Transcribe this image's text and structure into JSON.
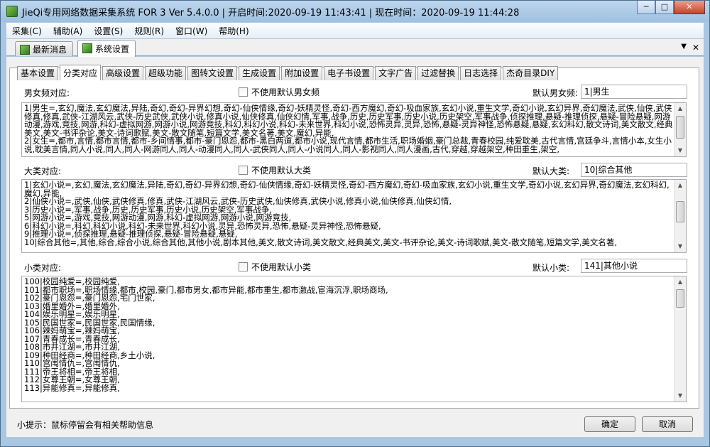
{
  "window": {
    "title": "JieQi专用网络数据采集系统 FOR 3 Ver 5.4.0.0 | 开启时间:2020-09-19 11:43:41 | 现在时间：2020-09-19 11:44:28",
    "minimize": "─",
    "maximize": "□",
    "close": "✕"
  },
  "menu": [
    "采集(C)",
    "辅助(A)",
    "设置(S)",
    "规则(R)",
    "窗口(W)",
    "帮助(H)"
  ],
  "mdi_tabs": [
    "最新消息",
    "系统设置"
  ],
  "mdi_controls": {
    "dropdown": "▼",
    "close": "✕"
  },
  "settings_tabs": [
    "基本设置",
    "分类对应",
    "高级设置",
    "超级功能",
    "图转文设置",
    "生成设置",
    "附加设置",
    "电子书设置",
    "文字广告",
    "过滤替换",
    "日志选择",
    "杰奇目录DIY"
  ],
  "gender": {
    "label": "男女频对应:",
    "checkbox": "不使用默认男女频",
    "default_label": "默认男女频:",
    "default_value": "1|男生",
    "lines": [
      "1|男生=,玄幻,魔法,玄幻魔法,异陆,奇幻,奇幻-异界幻想,奇幻-仙侠情缘,奇幻-妖精灵怪,奇幻-西方魔幻,奇幻-吸血家族,玄幻小说,重生文学,奇幻小说,玄幻异界,奇幻魔法,武侠,仙侠,武侠修真,修真,武侠-江湖风云,武侠-历史武侠,武侠小说,修真小说,仙侠修真,仙侠幻情,军事,战争,历史,历史军事,历史小说,历史架空,军事战争,侦探推理,悬疑-推理侦探,悬疑-冒险悬疑,网游动漫,游戏,竞技,网游,科幻-虚拟网游,网游小说,网游竞技,科幻,科幻小说,科幻-未来世界,科幻小说,恐怖灵异,灵异,恐怖,悬疑-灵异神怪,恐怖悬疑,悬疑,玄幻科幻,散文诗词,美文散文,经典美文,美文-书评杂论,美文-诗词歌赋,美文-散文随笔,短篇文学,美文名著,美文,魔幻,异能,",
      "2|女生=,都市,言情,都市言情,都市-乡间情事,都市-豪门恩怨,都市-黑白两道,都市小说,现代言情,都市生活,职场婚姻,豪门总裁,青春校园,纯爱耽美,古代言情,宫廷争斗,言情小本,女生小说,耽美言情,同人小说,同人,同人-网游同人,同人-动漫同人,同人-武侠同人,同人-小说同人,同人-影视同人,同人漫画,古代,穿越,穿越架空,种田重生,架空,"
    ]
  },
  "category": {
    "label": "大类对应:",
    "checkbox": "不使用默认大类",
    "default_label": "默认大类:",
    "default_value": "10|综合其他",
    "lines": [
      "1|玄幻小说=,玄幻,魔法,玄幻魔法,异陆,奇幻,奇幻-异界幻想,奇幻-仙侠情缘,奇幻-妖精灵怪,奇幻-西方魔幻,奇幻-吸血家族,玄幻小说,重生文学,奇幻小说,玄幻异界,奇幻魔法,玄幻科幻,魔幻,异能,",
      "2|仙侠小说=,武侠,仙侠,武侠修真,修真,武侠-江湖风云,武侠-历史武侠,仙侠修真,武侠小说,修真小说,仙侠修真,仙侠幻情,",
      "3|历史小说=,军事,战争,历史,历史军事,历史小说,历史架空,军事战争,",
      "5|网游小说=,游戏,竞技,网游动漫,网游,科幻-虚拟网游,网游小说,网游竞技,",
      "6|科幻小说=,科幻,科幻小说,科幻-未来世界,科幻小说,灵异,恐怖灵异,恐怖,悬疑-灵异神怪,恐怖悬疑,",
      "9|推理小说=,侦探推理,悬疑-推理侦探,悬疑-冒险悬疑,悬疑,",
      "10|综合其他=,其他,综合,综合小说,综合其他,其他小说,剧本其他,美文,散文诗词,美文散文,经典美文,美文-书评杂论,美文-诗词歌赋,美文-散文随笔,短篇文学,美文名著,"
    ]
  },
  "subcategory": {
    "label": "小类对应:",
    "checkbox": "不使用默认小类",
    "default_label": "默认小类:",
    "default_value": "141|其他小说",
    "lines": [
      "100|校园纯爱=,校园纯爱,",
      "101|都市职场=,职场情缘,都市,校园,豪门,都市男女,都市异能,都市重生,都市激战,宦海沉浮,职场商场,",
      "102|豪门恩怨=,豪门恩怨,宅门世家,",
      "103|婚里婚外=,婚里婚外,",
      "104|娱乐明星=,娱乐明星,",
      "105|民国世家=,民国世家,民国情缘,",
      "106|辣妈萌宝=,辣妈萌宝,",
      "107|青春成长=,青春成长,",
      "108|市井江湖=,市井江湖,",
      "109|种田经商=,种田经商,乡土小说,",
      "110|宫闱情仇=,宫闱情仇,",
      "111|帝王将相=,帝王将相,",
      "112|女尊王朝=,女尊王朝,",
      "113|异能修真=,异能修真,"
    ]
  },
  "hint": "小提示：鼠标停留会有相关帮助信息",
  "buttons": {
    "ok": "确定",
    "cancel": "取消"
  }
}
